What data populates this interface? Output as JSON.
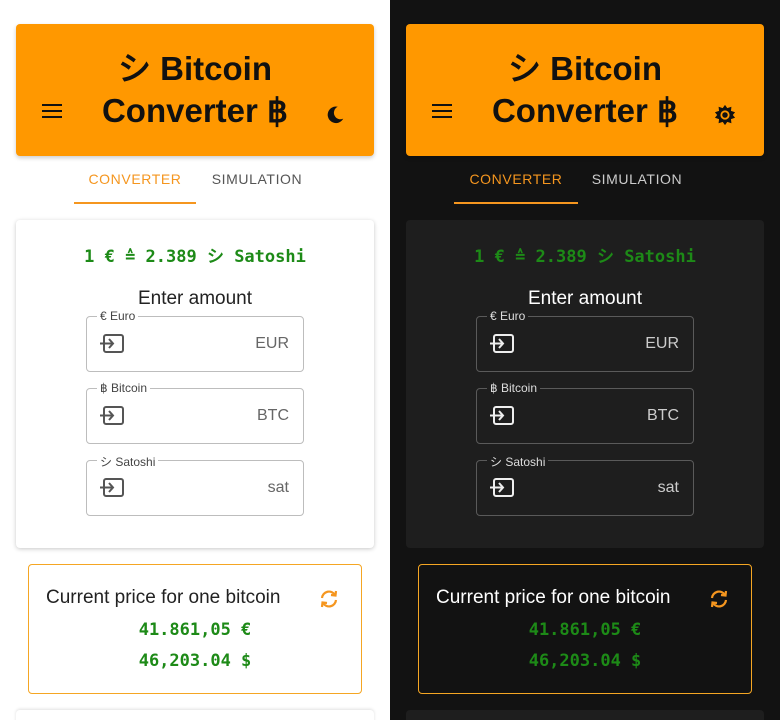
{
  "app": {
    "title_line1": "シ Bitcoin",
    "title_line2": "Converter ฿"
  },
  "tabs": [
    {
      "label": "CONVERTER",
      "active": true
    },
    {
      "label": "SIMULATION",
      "active": false
    }
  ],
  "converter": {
    "rate": "1 € ≙ 2.389 シ Satoshi",
    "enter_label": "Enter amount",
    "fields": [
      {
        "label": "€ Euro",
        "unit": "EUR",
        "value": ""
      },
      {
        "label": "฿ Bitcoin",
        "unit": "BTC",
        "value": ""
      },
      {
        "label": "シ Satoshi",
        "unit": "sat",
        "value": ""
      }
    ]
  },
  "price": {
    "title": "Current price for one bitcoin",
    "eur": "41.861,05 €",
    "usd": "46,203.04 $"
  },
  "icons": {
    "menu": "menu-icon",
    "light_theme_toggle": "moon-icon",
    "dark_theme_toggle": "sun-icon",
    "field_input": "input-arrow-icon",
    "refresh": "refresh-icon"
  },
  "colors": {
    "accent": "#ff9800",
    "tab_active": "#f5961f",
    "value_green": "#1d8a17",
    "dark_bg": "#121212",
    "dark_card": "#1e1e1e"
  }
}
